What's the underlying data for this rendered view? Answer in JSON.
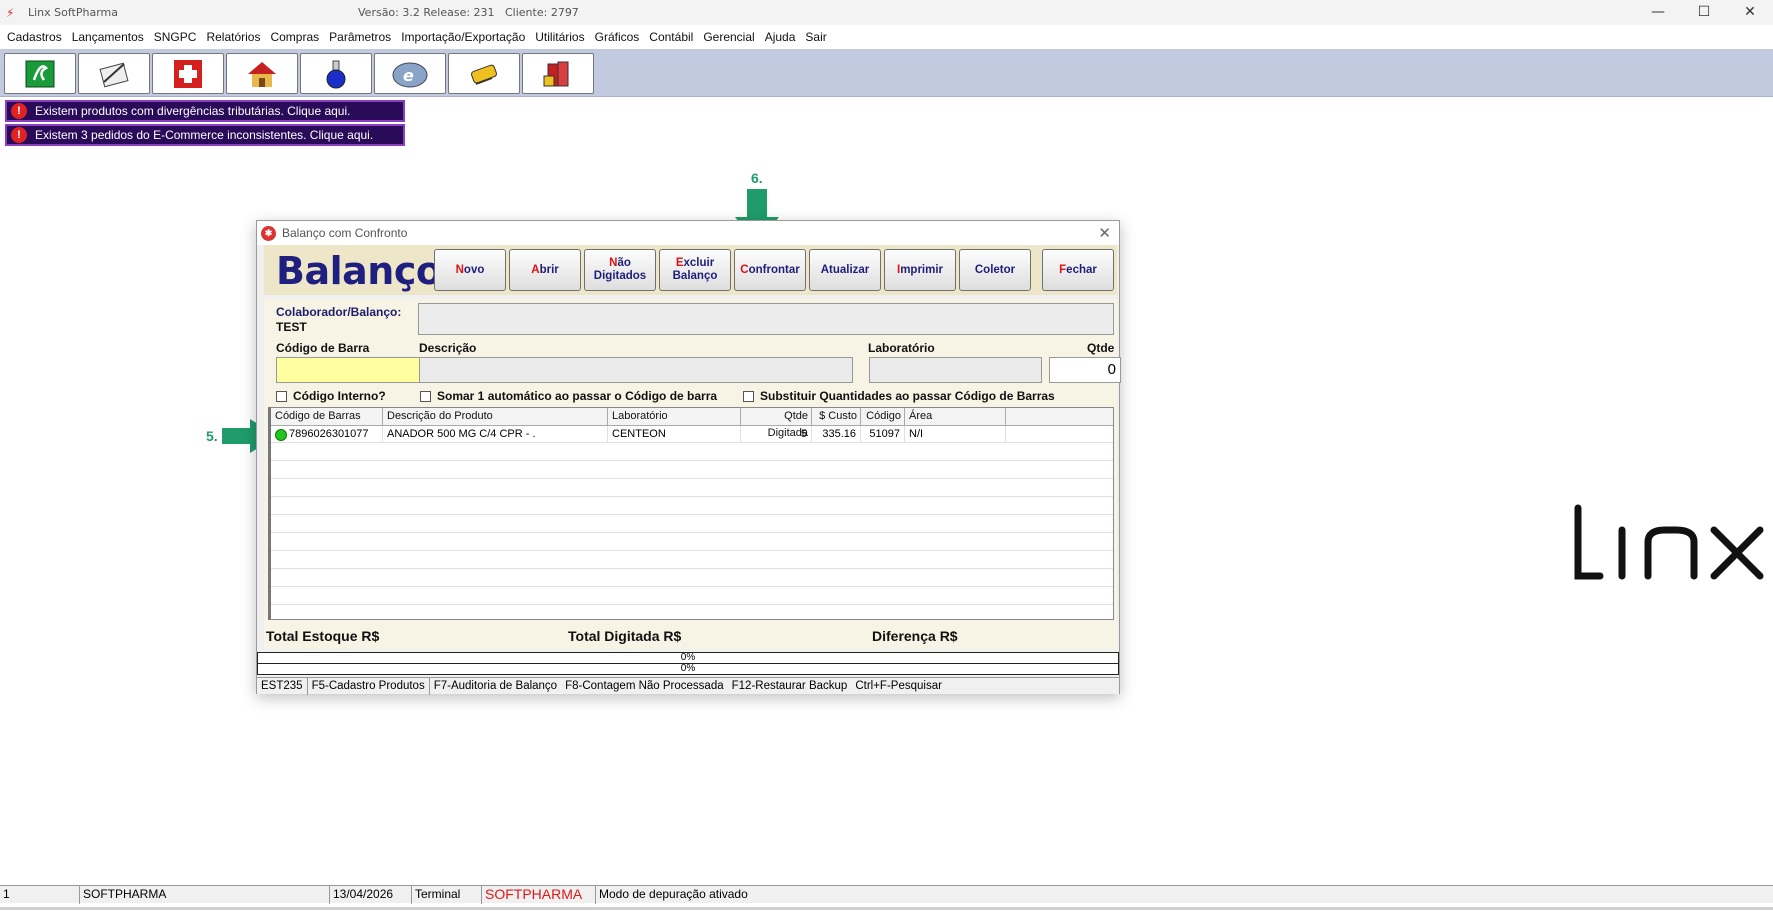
{
  "app": {
    "title": "Linx SoftPharma",
    "version": "Versão: 3.2 Release: 231",
    "client": "Cliente: 2797"
  },
  "window_controls": {
    "minimize": "—",
    "maximize": "☐",
    "close": "✕"
  },
  "menu": [
    "Cadastros",
    "Lançamentos",
    "SNGPC",
    "Relatórios",
    "Compras",
    "Parâmetros",
    "Importação/Exportação",
    "Utilitários",
    "Gráficos",
    "Contábil",
    "Gerencial",
    "Ajuda",
    "Sair"
  ],
  "toolbar_icons": [
    "cash-register-icon",
    "notepad-pen-icon",
    "pharmacy-cross-icon",
    "house-icon",
    "flask-icon",
    "nfe-icon",
    "dispenser-icon",
    "books-icon"
  ],
  "alerts": [
    "Existem produtos com divergências tributárias. Clique aqui.",
    "Existem 3 pedidos do E-Commerce inconsistentes. Clique aqui."
  ],
  "alert_icon": "!",
  "logo_text": "Linx",
  "dialog": {
    "title": "Balanço com Confronto",
    "close": "✕",
    "heading": "Balanço",
    "buttons": [
      {
        "hk": "N",
        "rest": "ovo"
      },
      {
        "hk": "A",
        "rest": "brir"
      },
      {
        "hk": "N",
        "rest": "ão Digitados"
      },
      {
        "hk": "E",
        "rest": "xcluir Balanço"
      },
      {
        "hk": "C",
        "rest": "onfrontar"
      },
      {
        "hk": "",
        "rest": "Atualizar"
      },
      {
        "hk": "I",
        "rest": "mprimir"
      },
      {
        "hk": "",
        "rest": "Coletor"
      },
      {
        "hk": "F",
        "rest": "echar"
      }
    ],
    "colaborador_label": "Colaborador/Balanço:",
    "colaborador_value": "TEST",
    "labels": {
      "codigo_barra": "Código de Barra",
      "descricao": "Descrição",
      "laboratorio": "Laboratório",
      "qtde": "Qtde"
    },
    "qtde_value": "0",
    "checkboxes": [
      "Código Interno?",
      "Somar 1 automático ao passar o Código de barra",
      "Substituir Quantidades ao passar Código de Barras"
    ],
    "grid": {
      "headers": [
        "Código de Barras",
        "Descrição do Produto",
        "Laboratório",
        "Qtde Digitada",
        "$ Custo",
        "Código",
        "Área"
      ],
      "rows": [
        [
          "7896026301077",
          "ANADOR 500 MG C/4 CPR - .",
          "CENTEON",
          "5",
          "335.16",
          "51097",
          "N/I"
        ]
      ]
    },
    "totals": {
      "estoque": "Total Estoque R$",
      "digitada": "Total Digitada R$",
      "diferenca": "Diferença R$"
    },
    "progress": [
      "0%",
      "0%"
    ],
    "status": [
      "EST235",
      "F5-Cadastro Produtos",
      "F7-Auditoria de Balanço",
      "F8-Contagem Não Processada",
      "F12-Restaurar Backup",
      "Ctrl+F-Pesquisar"
    ]
  },
  "annotations": {
    "step5": "5.",
    "step6": "6.",
    "arrow_color": "#1f9c6a"
  },
  "statusbar": [
    "1",
    "SOFTPHARMA",
    "13/04/2026",
    "Terminal",
    "SOFTPHARMA",
    "Modo de depuração ativado"
  ]
}
